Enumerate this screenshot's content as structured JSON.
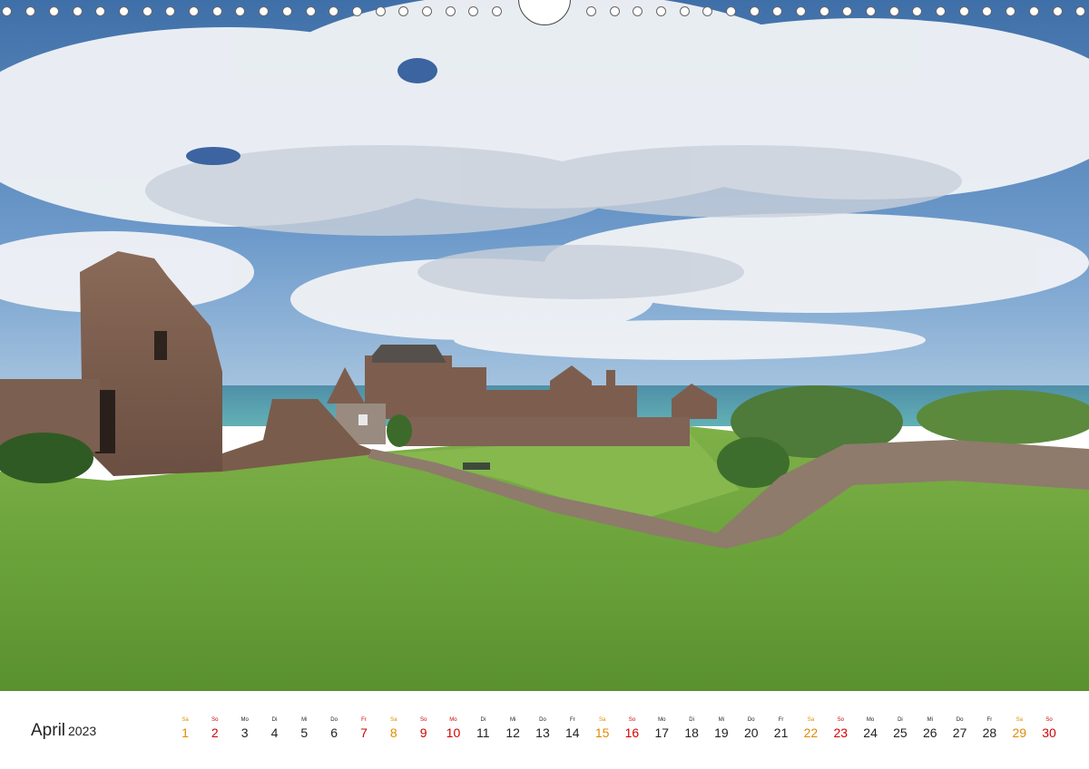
{
  "calendar": {
    "month": "April",
    "year": "2023",
    "colors": {
      "weekday": "#222222",
      "saturday": "#e08a00",
      "sunday": "#d40000"
    },
    "days": [
      {
        "wd": "Sa",
        "n": "1",
        "k": "sat"
      },
      {
        "wd": "So",
        "n": "2",
        "k": "sun"
      },
      {
        "wd": "Mo",
        "n": "3",
        "k": "weekday"
      },
      {
        "wd": "Di",
        "n": "4",
        "k": "weekday"
      },
      {
        "wd": "Mi",
        "n": "5",
        "k": "weekday"
      },
      {
        "wd": "Do",
        "n": "6",
        "k": "weekday"
      },
      {
        "wd": "Fr",
        "n": "7",
        "k": "hol"
      },
      {
        "wd": "Sa",
        "n": "8",
        "k": "sat"
      },
      {
        "wd": "So",
        "n": "9",
        "k": "sun"
      },
      {
        "wd": "Mo",
        "n": "10",
        "k": "hol"
      },
      {
        "wd": "Di",
        "n": "11",
        "k": "weekday"
      },
      {
        "wd": "Mi",
        "n": "12",
        "k": "weekday"
      },
      {
        "wd": "Do",
        "n": "13",
        "k": "weekday"
      },
      {
        "wd": "Fr",
        "n": "14",
        "k": "weekday"
      },
      {
        "wd": "Sa",
        "n": "15",
        "k": "sat"
      },
      {
        "wd": "So",
        "n": "16",
        "k": "sun"
      },
      {
        "wd": "Mo",
        "n": "17",
        "k": "weekday"
      },
      {
        "wd": "Di",
        "n": "18",
        "k": "weekday"
      },
      {
        "wd": "Mi",
        "n": "19",
        "k": "weekday"
      },
      {
        "wd": "Do",
        "n": "20",
        "k": "weekday"
      },
      {
        "wd": "Fr",
        "n": "21",
        "k": "weekday"
      },
      {
        "wd": "Sa",
        "n": "22",
        "k": "sat"
      },
      {
        "wd": "So",
        "n": "23",
        "k": "sun"
      },
      {
        "wd": "Mo",
        "n": "24",
        "k": "weekday"
      },
      {
        "wd": "Di",
        "n": "25",
        "k": "weekday"
      },
      {
        "wd": "Mi",
        "n": "26",
        "k": "weekday"
      },
      {
        "wd": "Do",
        "n": "27",
        "k": "weekday"
      },
      {
        "wd": "Fr",
        "n": "28",
        "k": "weekday"
      },
      {
        "wd": "Sa",
        "n": "29",
        "k": "sat"
      },
      {
        "wd": "So",
        "n": "30",
        "k": "sun"
      }
    ]
  },
  "photo": {
    "subject": "castle-ruins-landscape-image"
  }
}
